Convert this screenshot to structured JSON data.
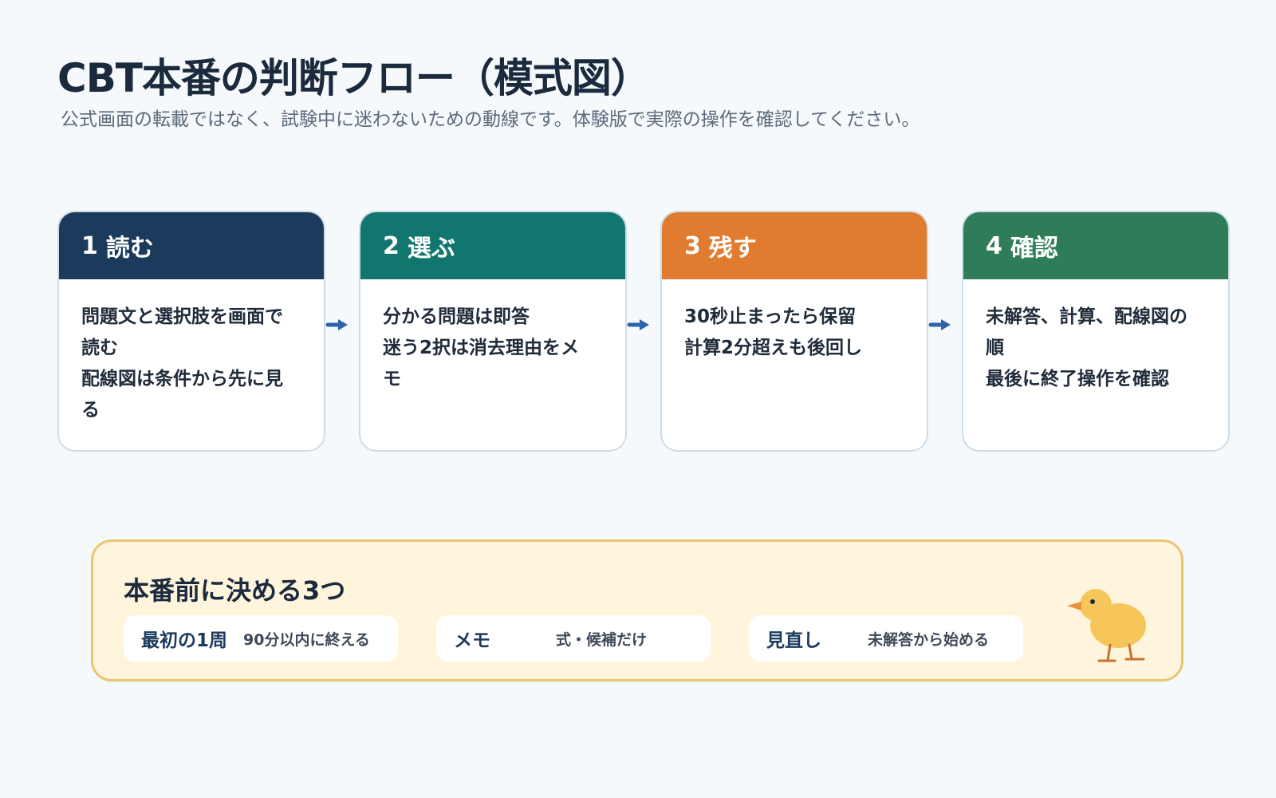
{
  "title": "CBT本番の判断フロー（模式図）",
  "subtitle": "公式画面の転載ではなく、試験中に迷わないための動線です。体験版で実際の操作を確認してください。",
  "steps": [
    {
      "num": "1",
      "label": "読む",
      "color": "#1b3a5c",
      "lines": [
        "問題文と選択肢を画面で",
        "読む",
        "配線図は条件から先に見",
        "る"
      ]
    },
    {
      "num": "2",
      "label": "選ぶ",
      "color": "#11776e",
      "lines": [
        "分かる問題は即答",
        "迷う2択は消去理由をメ",
        "モ"
      ]
    },
    {
      "num": "3",
      "label": "残す",
      "color": "#e07b30",
      "lines": [
        "30秒止まったら保留",
        "計算2分超えも後回し"
      ]
    },
    {
      "num": "4",
      "label": "確認",
      "color": "#2e7d58",
      "lines": [
        "未解答、計算、配線図の",
        "順",
        "最後に終了操作を確認"
      ]
    }
  ],
  "arrow_color": "#2f63a8",
  "notes": {
    "title": "本番前に決める3つ",
    "items": [
      {
        "label": "最初の1周",
        "value": "90分以内に終える"
      },
      {
        "label": "メモ",
        "value": "式・候補だけ"
      },
      {
        "label": "見直し",
        "value": "未解答から始める"
      }
    ]
  }
}
